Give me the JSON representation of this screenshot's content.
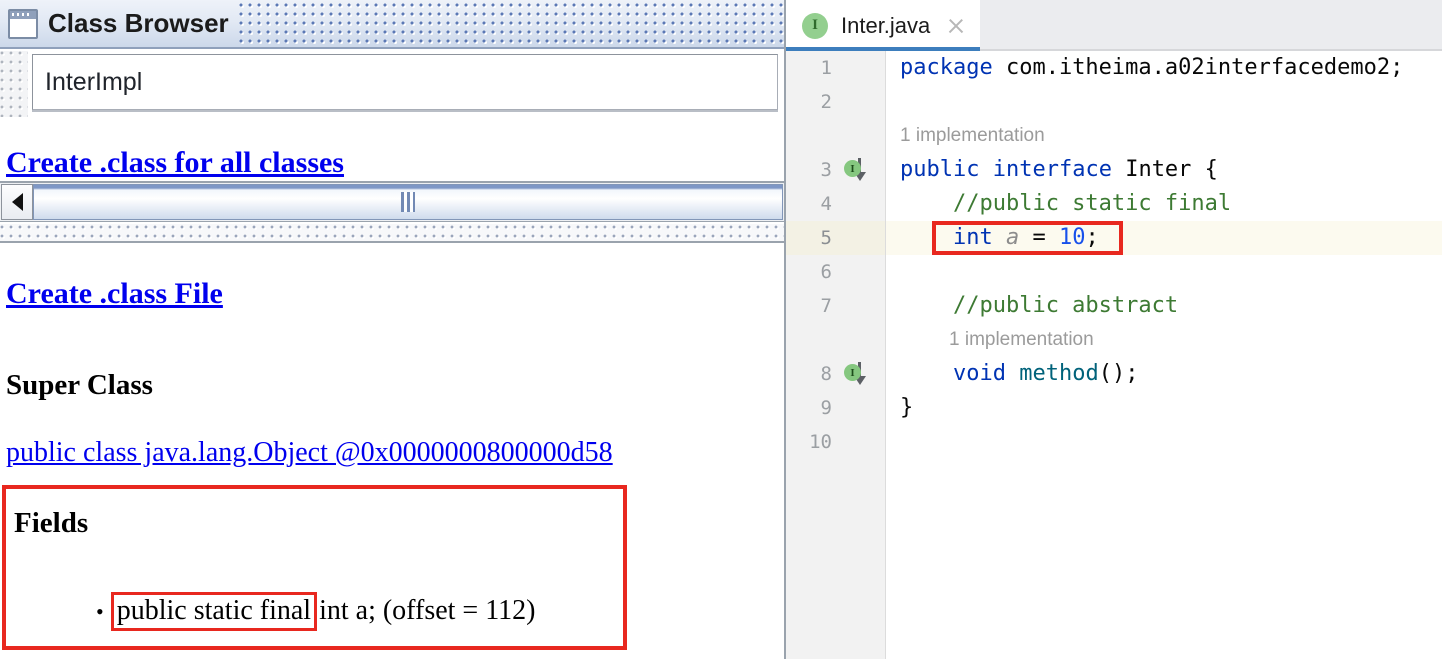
{
  "class_browser": {
    "window_icon": "window-frame-icon",
    "title": "Class Browser",
    "class_field_value": "InterImpl",
    "clipped_link": "Create .class for all classes",
    "create_class_file_link": "Create .class File",
    "super_class_heading": "Super Class",
    "super_class_link": "public class java.lang.Object @0x0000000800000d58",
    "fields_heading": "Fields",
    "field_entry": {
      "bullet": "•",
      "highlighted_modifier": "public static final",
      "rest": " int a; (offset = 112)"
    },
    "scrollbar": {
      "left_arrow": "◀",
      "thumb_grip": "grip-lines-icon"
    }
  },
  "editor": {
    "tab": {
      "icon_letter": "I",
      "icon_name": "interface-icon",
      "label": "Inter.java",
      "close_icon": "close-icon"
    },
    "gutter_marker_letter": "I",
    "hints": {
      "implementation_line3": "1 implementation",
      "implementation_line8": "1 implementation"
    },
    "lines": [
      {
        "no": "1",
        "marker": false,
        "highlight": false,
        "tokens": [
          {
            "t": "package",
            "c": "t-kw"
          },
          {
            "t": " com.itheima.a02interfacedemo2;",
            "c": "t-plain"
          }
        ]
      },
      {
        "no": "2",
        "marker": false,
        "highlight": false,
        "tokens": []
      },
      {
        "no": "3",
        "marker": true,
        "highlight": false,
        "tokens": [
          {
            "t": "public",
            "c": "t-kw"
          },
          {
            "t": " ",
            "c": "t-plain"
          },
          {
            "t": "interface",
            "c": "t-kw"
          },
          {
            "t": " Inter {",
            "c": "t-plain"
          }
        ]
      },
      {
        "no": "4",
        "marker": false,
        "highlight": false,
        "tokens": [
          {
            "t": "    //public static final",
            "c": "t-com"
          }
        ]
      },
      {
        "no": "5",
        "marker": false,
        "highlight": true,
        "boxed": true,
        "tokens": [
          {
            "t": "    ",
            "c": "t-plain"
          },
          {
            "t": "int",
            "c": "t-kw"
          },
          {
            "t": " ",
            "c": "t-plain"
          },
          {
            "t": "a",
            "c": "t-field"
          },
          {
            "t": " = ",
            "c": "t-plain"
          },
          {
            "t": "10",
            "c": "t-num"
          },
          {
            "t": ";",
            "c": "t-plain"
          }
        ]
      },
      {
        "no": "6",
        "marker": false,
        "highlight": false,
        "tokens": []
      },
      {
        "no": "7",
        "marker": false,
        "highlight": false,
        "tokens": [
          {
            "t": "    //public abstract",
            "c": "t-com"
          }
        ]
      },
      {
        "no": "8",
        "marker": true,
        "highlight": false,
        "tokens": [
          {
            "t": "    ",
            "c": "t-plain"
          },
          {
            "t": "void",
            "c": "t-kw"
          },
          {
            "t": " ",
            "c": "t-plain"
          },
          {
            "t": "method",
            "c": "t-method"
          },
          {
            "t": "();",
            "c": "t-plain"
          }
        ]
      },
      {
        "no": "9",
        "marker": false,
        "highlight": false,
        "tokens": [
          {
            "t": "}",
            "c": "t-plain"
          }
        ]
      },
      {
        "no": "10",
        "marker": false,
        "highlight": false,
        "tokens": []
      }
    ]
  },
  "colors": {
    "annotation_red": "#e8281f",
    "tab_underline_blue": "#3d7ebd",
    "link_blue": "#0000ee",
    "interface_icon_green": "#85c77f",
    "keyword_blue": "#0033b3",
    "comment_green": "#3d7a33",
    "highlight_line_yellow": "#fcfaef"
  }
}
